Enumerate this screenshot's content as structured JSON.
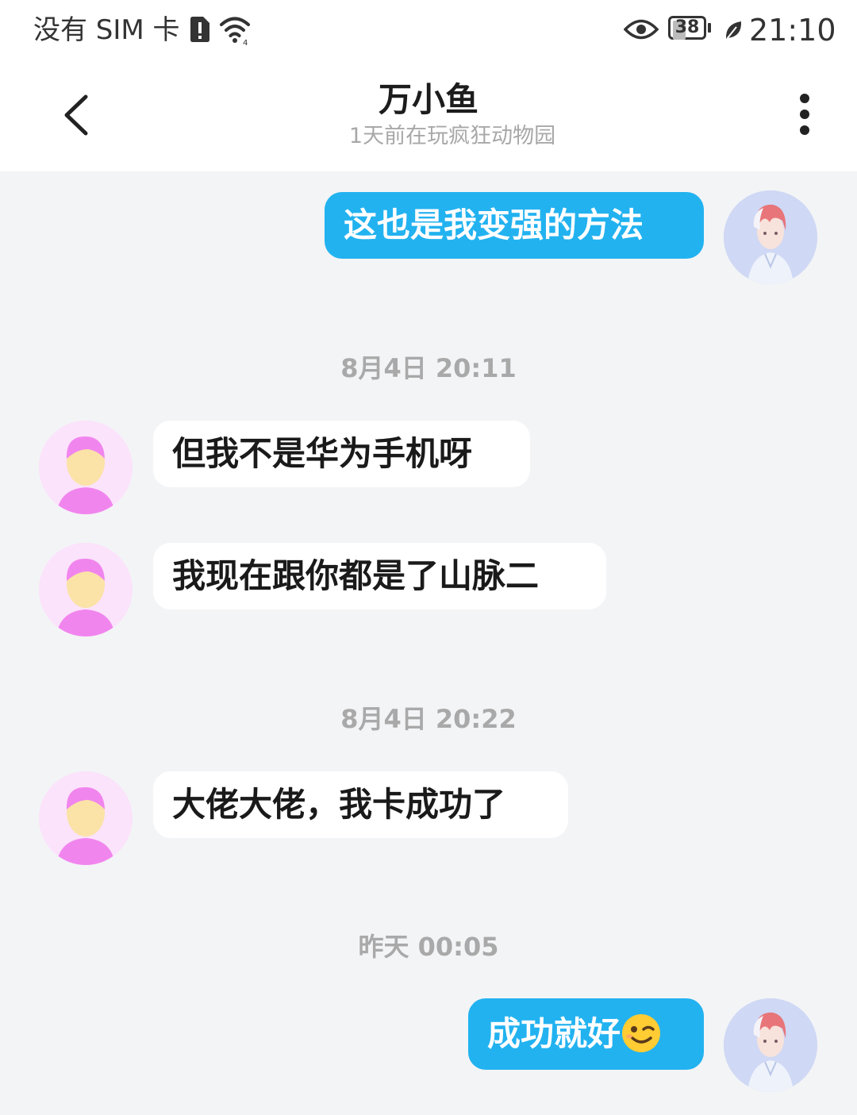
{
  "status_bar": {
    "carrier": "没有 SIM 卡",
    "battery": "38",
    "battery_level": 0.38,
    "time": "21:10",
    "icons": [
      "sim-alert-icon",
      "wifi-icon",
      "eye-icon",
      "battery-icon",
      "leaf-icon"
    ]
  },
  "header": {
    "title": "万小鱼",
    "subtitle": "1天前在玩疯狂动物园",
    "back_icon": "chevron-left-icon",
    "more_icon": "more-vertical-icon"
  },
  "messages": [
    {
      "sender": "self",
      "text": "这也是我变强的方法"
    },
    {
      "type": "timestamp",
      "text": "8月4日 20:11"
    },
    {
      "sender": "other",
      "text": "但我不是华为手机呀"
    },
    {
      "sender": "other",
      "text": "我现在跟你都是了山脉二"
    },
    {
      "type": "timestamp",
      "text": "8月4日 20:22"
    },
    {
      "sender": "other",
      "text": "大佬大佬，我卡成功了"
    },
    {
      "type": "timestamp",
      "text": "昨天 00:05"
    },
    {
      "sender": "self",
      "text": "成功就好",
      "emoji": "wink-emoji"
    }
  ],
  "colors": {
    "self_bubble": "#22b2f0",
    "other_bubble": "#ffffff",
    "background": "#f3f4f6",
    "timestamp": "#a9a9a9"
  }
}
